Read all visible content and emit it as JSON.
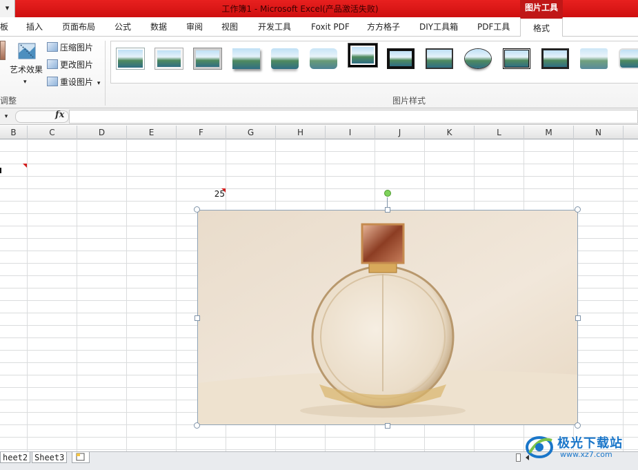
{
  "titlebar": {
    "qat_arrow": "▾",
    "title": "工作簿1 - Microsoft Excel(产品激活失败)",
    "context_tab": "图片工具"
  },
  "tabs": [
    {
      "label": "板"
    },
    {
      "label": "插入"
    },
    {
      "label": "页面布局"
    },
    {
      "label": "公式"
    },
    {
      "label": "数据"
    },
    {
      "label": "审阅"
    },
    {
      "label": "视图"
    },
    {
      "label": "开发工具"
    },
    {
      "label": "Foxit PDF"
    },
    {
      "label": "方方格子"
    },
    {
      "label": "DIY工具箱"
    },
    {
      "label": "PDF工具"
    },
    {
      "label": "格式"
    }
  ],
  "ribbon": {
    "adjust_group": {
      "art_effects": "艺术效果",
      "art_effects_arrow": "▾",
      "compress": "压缩图片",
      "change": "更改图片",
      "reset": "重设图片",
      "reset_arrow": "▾",
      "label": "调整"
    },
    "styles_group": {
      "label": "图片样式",
      "thumbnails": [
        {
          "style": "simple-frame-white"
        },
        {
          "style": "beveled-matte-white"
        },
        {
          "style": "metal-frame"
        },
        {
          "style": "drop-shadow-rectangle"
        },
        {
          "style": "reflected-rounded"
        },
        {
          "style": "soft-edge-rectangle"
        },
        {
          "style": "double-frame-black"
        },
        {
          "style": "thick-matte-black"
        },
        {
          "style": "simple-frame-black"
        },
        {
          "style": "oval-reflected"
        },
        {
          "style": "compound-frame-black"
        },
        {
          "style": "center-shadow"
        },
        {
          "style": "soft-edge-light"
        },
        {
          "style": "rounded-white"
        }
      ]
    }
  },
  "formula_bar": {
    "namebox_arrow": "▾",
    "fx": "fx",
    "value": ""
  },
  "columns": [
    "B",
    "C",
    "D",
    "E",
    "F",
    "G",
    "H",
    "I",
    "J",
    "K",
    "L",
    "M",
    "N"
  ],
  "cells": {
    "value_25": "25"
  },
  "picture": {
    "description_icon": "perfume-bottle-image"
  },
  "sheets": {
    "tabs": [
      "heet2",
      "Sheet3"
    ]
  },
  "watermark": {
    "text": "极光下载站",
    "url": "www.xz7.com"
  },
  "colors": {
    "title_red": "#d21414",
    "context_tab": "#c01717",
    "grid_line": "#dadcdd",
    "watermark_blue": "#1a76c9"
  }
}
